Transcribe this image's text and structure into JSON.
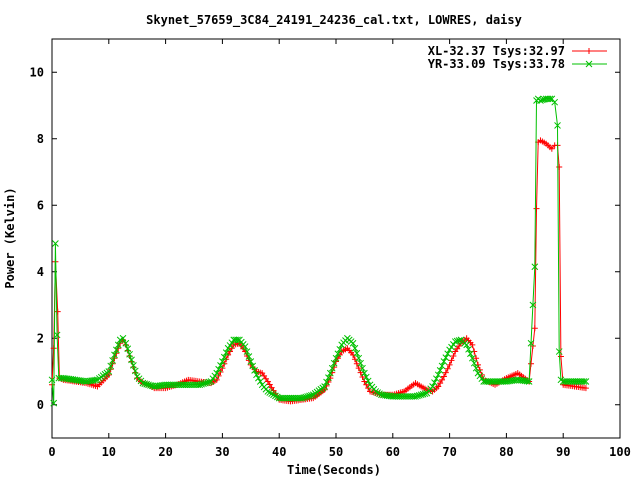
{
  "chart_data": {
    "type": "line",
    "title": "Skynet_57659_3C84_24191_24236_cal.txt, LOWRES, daisy",
    "xlabel": "Time(Seconds)",
    "ylabel": "Power (Kelvin)",
    "xlim": [
      0,
      100
    ],
    "ylim": [
      -1,
      11
    ],
    "xticks": [
      0,
      10,
      20,
      30,
      40,
      50,
      60,
      70,
      80,
      90,
      100
    ],
    "yticks": [
      0,
      2,
      4,
      6,
      8,
      10
    ],
    "grid": false,
    "legend_position": "top-right",
    "series": [
      {
        "name": "XL-32.37 Tsys:32.97",
        "color": "#ff0000",
        "marker": "plus",
        "x": [
          0,
          0.3,
          0.6,
          1.0,
          1.3,
          2,
          4,
          6,
          8,
          10,
          11,
          12,
          12.5,
          13,
          14,
          15,
          16,
          17,
          18,
          20,
          22,
          24,
          26,
          28,
          29,
          30,
          31,
          32,
          33,
          34,
          35,
          36,
          37,
          38,
          40,
          42,
          44,
          46,
          48,
          49,
          50,
          51,
          52,
          53,
          54,
          55,
          56,
          57,
          58,
          60,
          62,
          64,
          66,
          67,
          68,
          69,
          70,
          71,
          72,
          73,
          74,
          75,
          76,
          78,
          80,
          82,
          84,
          85.0,
          85.3,
          85.6,
          86,
          87,
          88,
          88.5,
          89.0,
          89.3,
          89.6,
          90,
          92,
          94
        ],
        "values": [
          0.6,
          1.7,
          4.3,
          2.8,
          0.8,
          0.75,
          0.7,
          0.65,
          0.55,
          0.9,
          1.4,
          1.85,
          1.95,
          1.8,
          1.3,
          0.8,
          0.65,
          0.6,
          0.5,
          0.5,
          0.6,
          0.75,
          0.7,
          0.65,
          0.75,
          1.1,
          1.5,
          1.8,
          1.85,
          1.6,
          1.2,
          1.0,
          0.95,
          0.7,
          0.15,
          0.1,
          0.15,
          0.2,
          0.45,
          0.8,
          1.3,
          1.6,
          1.7,
          1.5,
          1.1,
          0.7,
          0.4,
          0.35,
          0.3,
          0.3,
          0.4,
          0.65,
          0.45,
          0.4,
          0.55,
          0.85,
          1.2,
          1.6,
          1.85,
          2.0,
          1.8,
          1.2,
          0.75,
          0.6,
          0.8,
          0.95,
          0.7,
          2.3,
          5.9,
          7.9,
          7.95,
          7.85,
          7.7,
          7.8,
          7.8,
          7.15,
          1.45,
          0.6,
          0.55,
          0.5
        ]
      },
      {
        "name": "YR-33.09 Tsys:33.78",
        "color": "#00c000",
        "marker": "cross",
        "x": [
          0,
          0.3,
          0.6,
          0.9,
          1.2,
          2,
          4,
          6,
          8,
          10,
          11,
          12,
          12.5,
          13,
          14,
          15,
          16,
          17,
          18,
          20,
          22,
          24,
          26,
          28,
          29,
          30,
          31,
          32,
          33,
          34,
          35,
          36,
          37,
          38,
          40,
          42,
          44,
          46,
          48,
          49,
          50,
          51,
          52,
          53,
          54,
          55,
          56,
          57,
          58,
          60,
          62,
          64,
          66,
          67,
          68,
          69,
          70,
          71,
          72,
          73,
          74,
          75,
          76,
          78,
          80,
          82,
          84,
          85.0,
          85.3,
          85.6,
          86,
          87,
          88,
          88.5,
          89.0,
          89.3,
          89.6,
          90,
          92,
          94
        ],
        "values": [
          0.75,
          0.05,
          4.85,
          2.1,
          0.8,
          0.8,
          0.75,
          0.7,
          0.75,
          1.0,
          1.5,
          1.95,
          2.0,
          1.85,
          1.35,
          0.85,
          0.65,
          0.6,
          0.55,
          0.6,
          0.6,
          0.6,
          0.6,
          0.7,
          0.95,
          1.3,
          1.7,
          1.95,
          1.95,
          1.75,
          1.3,
          0.9,
          0.6,
          0.4,
          0.2,
          0.2,
          0.2,
          0.3,
          0.55,
          0.95,
          1.4,
          1.8,
          2.0,
          1.85,
          1.4,
          0.95,
          0.6,
          0.4,
          0.3,
          0.25,
          0.25,
          0.25,
          0.35,
          0.55,
          0.9,
          1.3,
          1.65,
          1.9,
          1.95,
          1.8,
          1.4,
          0.95,
          0.7,
          0.7,
          0.7,
          0.75,
          0.7,
          4.15,
          9.15,
          9.2,
          9.15,
          9.2,
          9.2,
          9.1,
          8.4,
          1.6,
          0.75,
          0.7,
          0.7,
          0.7
        ]
      }
    ]
  }
}
